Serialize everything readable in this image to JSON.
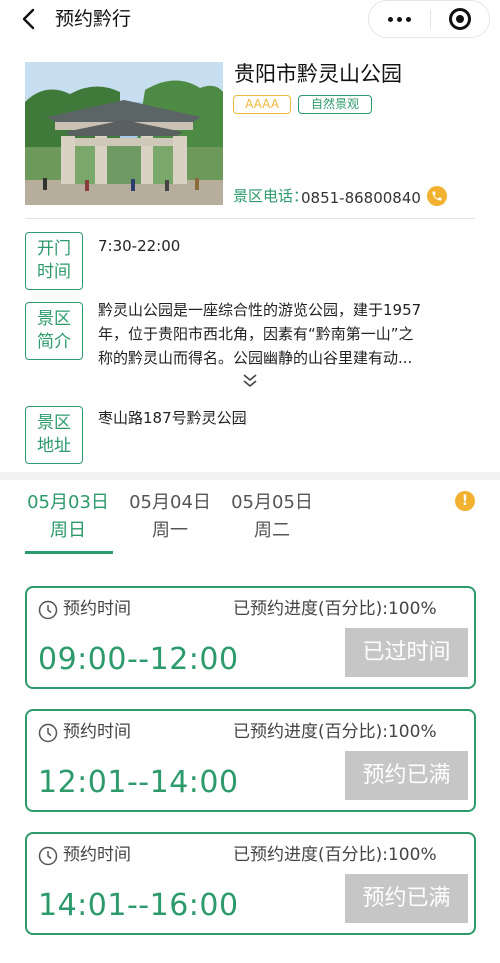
{
  "header": {
    "title": "预约黔行",
    "back_icon": "chevron-left-icon",
    "more_icon": "more-dots-icon",
    "close_icon": "target-close-icon"
  },
  "park": {
    "name": "贵阳市黔灵山公园",
    "level_tag": "AAAA",
    "category_tag": "自然景观",
    "phone_label": "景区电话：",
    "phone": "0851-86800840",
    "phone_icon": "phone-icon"
  },
  "info": {
    "open_label_1": "开门",
    "open_label_2": "时间",
    "open_time": "7:30-22:00",
    "intro_label_1": "景区",
    "intro_label_2": "简介",
    "intro_line_1": "黔灵山公园是一座综合性的游览公园，建于1957",
    "intro_line_2": "年，位于贵阳市西北角，因素有“黔南第一山”之",
    "intro_line_3": "称的黔灵山而得名。公园幽静的山谷里建有动...",
    "expand_icon": "double-chevron-down-icon",
    "address_label_1": "景区",
    "address_label_2": "地址",
    "address": "枣山路187号黔灵公园"
  },
  "dates": [
    {
      "date": "05月03日",
      "weekday": "周日",
      "active": true
    },
    {
      "date": "05月04日",
      "weekday": "周一",
      "active": false
    },
    {
      "date": "05月05日",
      "weekday": "周二",
      "active": false
    }
  ],
  "tip_icon": "!",
  "slots": [
    {
      "label": "预约时间",
      "progress": "已预约进度(百分比):100%",
      "time": "09:00--12:00",
      "button": "已过时间"
    },
    {
      "label": "预约时间",
      "progress": "已预约进度(百分比):100%",
      "time": "12:01--14:00",
      "button": "预约已满"
    },
    {
      "label": "预约时间",
      "progress": "已预约进度(百分比):100%",
      "time": "14:01--16:00",
      "button": "预约已满"
    }
  ],
  "colors": {
    "accent": "#2c9a6b",
    "warning": "#f2b12f",
    "disabled_button": "#c6c6c6"
  }
}
